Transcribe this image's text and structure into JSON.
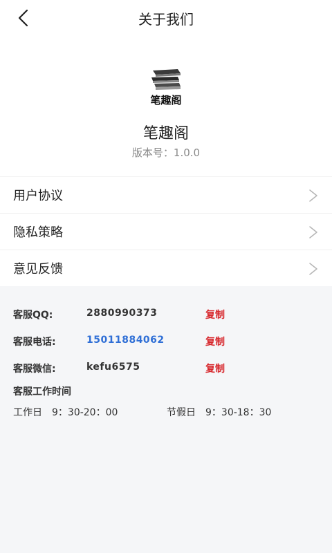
{
  "header": {
    "title": "关于我们"
  },
  "app": {
    "logo_text": "笔趣阁",
    "name": "笔趣阁",
    "version": "版本号：1.0.0"
  },
  "menu": {
    "items": [
      {
        "label": "用户协议"
      },
      {
        "label": "隐私策略"
      },
      {
        "label": "意见反馈"
      }
    ]
  },
  "contact": {
    "qq_label": "客服QQ:",
    "qq_value": "2880990373",
    "phone_label": "客服电话:",
    "phone_value": "15011884062",
    "wechat_label": "客服微信:",
    "wechat_value": "kefu6575",
    "copy_label": "复制",
    "hours_title": "客服工作时间",
    "weekday_hours": "工作日　9：30-20：00",
    "holiday_hours": "节假日　9：30-18：30"
  },
  "colors": {
    "link": "#2f6fd6",
    "copy": "#d7262b",
    "background": "#f5f6f8"
  },
  "icons": {
    "back": "chevron-left-icon",
    "menu_arrow": "chevron-right-icon",
    "logo": "books-stack-icon"
  }
}
